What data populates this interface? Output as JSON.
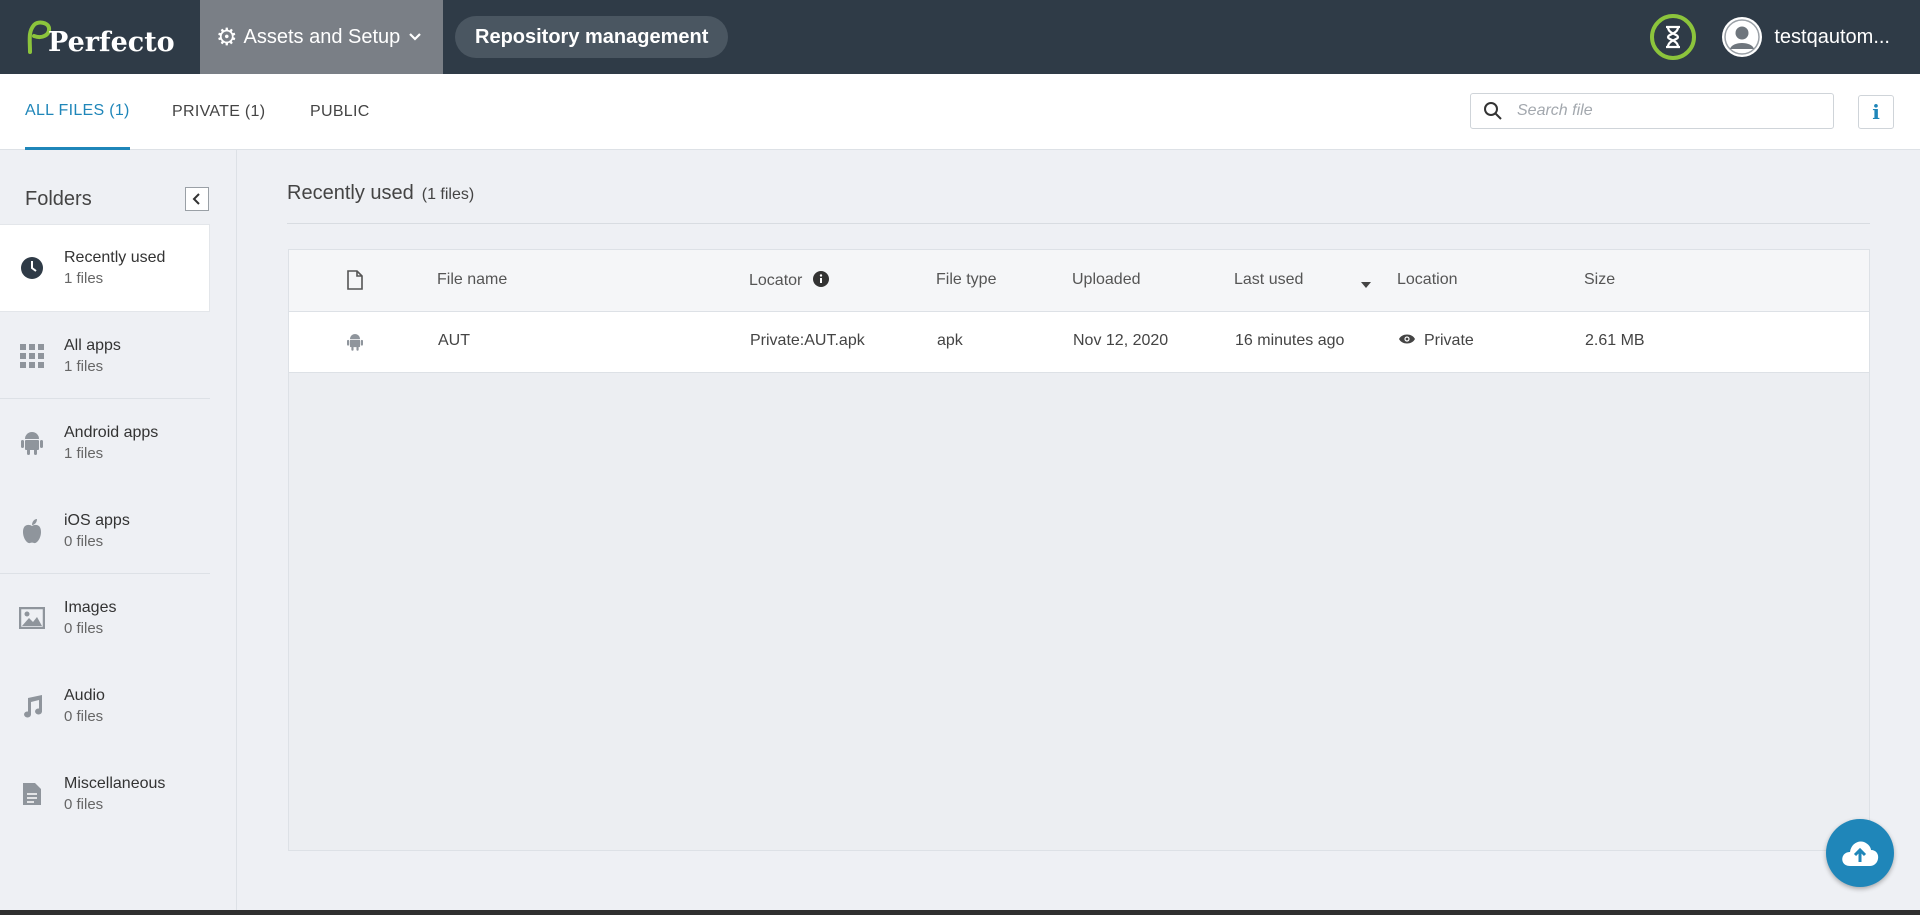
{
  "header": {
    "logo_text": "Perfecto",
    "assets_menu_label": "Assets and Setup",
    "page_pill": "Repository management",
    "username": "testqautom..."
  },
  "tabs": [
    {
      "label": "ALL FILES (1)",
      "active": true
    },
    {
      "label": "PRIVATE (1)",
      "active": false
    },
    {
      "label": "PUBLIC",
      "active": false
    }
  ],
  "search": {
    "placeholder": "Search file"
  },
  "info_button": "i",
  "sidebar": {
    "title": "Folders",
    "folders": [
      {
        "name": "Recently used",
        "count": "1 files",
        "icon": "clock-icon"
      },
      {
        "name": "All apps",
        "count": "1 files",
        "icon": "grid-icon"
      },
      {
        "name": "Android apps",
        "count": "1 files",
        "icon": "android-icon"
      },
      {
        "name": "iOS apps",
        "count": "0 files",
        "icon": "apple-icon"
      },
      {
        "name": "Images",
        "count": "0 files",
        "icon": "image-icon"
      },
      {
        "name": "Audio",
        "count": "0 files",
        "icon": "music-note-icon"
      },
      {
        "name": "Miscellaneous",
        "count": "0 files",
        "icon": "document-icon"
      }
    ]
  },
  "main": {
    "title": "Recently used",
    "title_count": "(1 files)",
    "columns": [
      "File name",
      "Locator",
      "File type",
      "Uploaded",
      "Last used",
      "Location",
      "Size"
    ],
    "rows": [
      {
        "file_name": "AUT",
        "locator": "Private:AUT.apk",
        "file_type": "apk",
        "uploaded": "Nov 12, 2020",
        "last_used": "16 minutes ago",
        "location": "Private",
        "size": "2.61 MB"
      }
    ]
  },
  "colors": {
    "topbar": "#2f3b47",
    "accent": "#1f86b9",
    "timer_ring": "#8cc43c"
  }
}
